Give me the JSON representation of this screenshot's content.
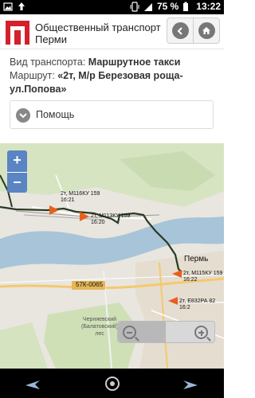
{
  "status_bar": {
    "battery": "75 %",
    "time": "13:22"
  },
  "header": {
    "title": "Общественный транспорт Перми"
  },
  "info": {
    "transport_label": "Вид транспорта:",
    "transport_value": "Маршрутное такси",
    "route_label": "Маршрут:",
    "route_value": "«2т, М/р Березовая роща-ул.Попова»"
  },
  "help": {
    "label": "Помощь"
  },
  "map": {
    "zoom_in": "+",
    "zoom_out": "−",
    "labels": {
      "bus1_id": "2т, М116КУ 159",
      "bus1_time": "16:21",
      "bus2_id": "2т, М113КУ 159",
      "bus2_time": "16:20",
      "bus3_id": "2т, М115КУ 159",
      "bus3_time": "16:22",
      "bus4_id": "2т, Е832РА 82",
      "bus4_time": "16:2",
      "city": "Пермь",
      "road": "57К-0065",
      "forest_l1": "Черняевский",
      "forest_l2": "(Балатовский)",
      "forest_l3": "лес"
    },
    "colors": {
      "route": "#2b3a22",
      "bus_marker": "#e8601c",
      "water": "#a8c4d8",
      "park": "#c8dcae"
    }
  }
}
